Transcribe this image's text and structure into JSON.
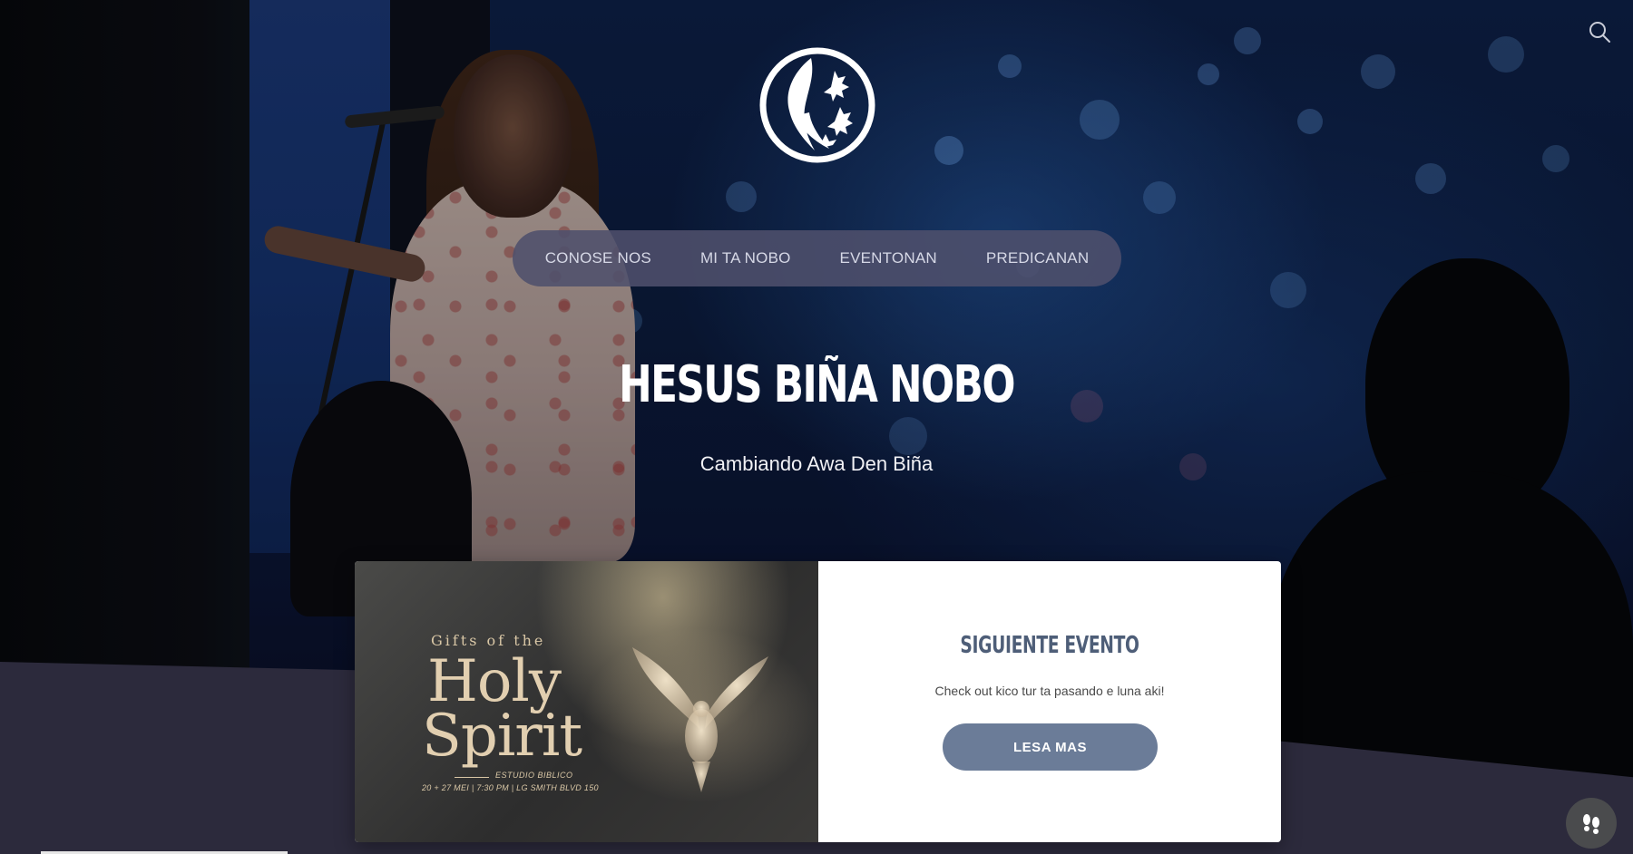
{
  "header": {
    "search_icon": "search-icon",
    "logo_icon": "church-logo-icon"
  },
  "nav": {
    "items": [
      {
        "label": "CONOSE NOS"
      },
      {
        "label": "MI TA NOBO"
      },
      {
        "label": "EVENTONAN"
      },
      {
        "label": "PREDICANAN"
      }
    ]
  },
  "hero": {
    "title": "HESUS BIÑA NOBO",
    "subtitle": "Cambiando Awa Den Biña"
  },
  "event_card": {
    "image": {
      "top_text": "Gifts of the",
      "title_line1": "Holy",
      "title_line2": "Spirit",
      "label": "ESTUDIO BIBLICO",
      "details": "20 + 27 MEI | 7:30 PM | LG SMITH BLVD 150"
    },
    "heading": "SIGUIENTE EVENTO",
    "text": "Check out kico tur ta pasando e luna aki!",
    "button_label": "LESA MAS"
  },
  "accessibility": {
    "icon": "footprints-icon"
  },
  "colors": {
    "nav_bg": "#4e506c",
    "button_bg": "#6b7c98",
    "heading": "#4e5e78",
    "band": "#2c2a3c"
  }
}
